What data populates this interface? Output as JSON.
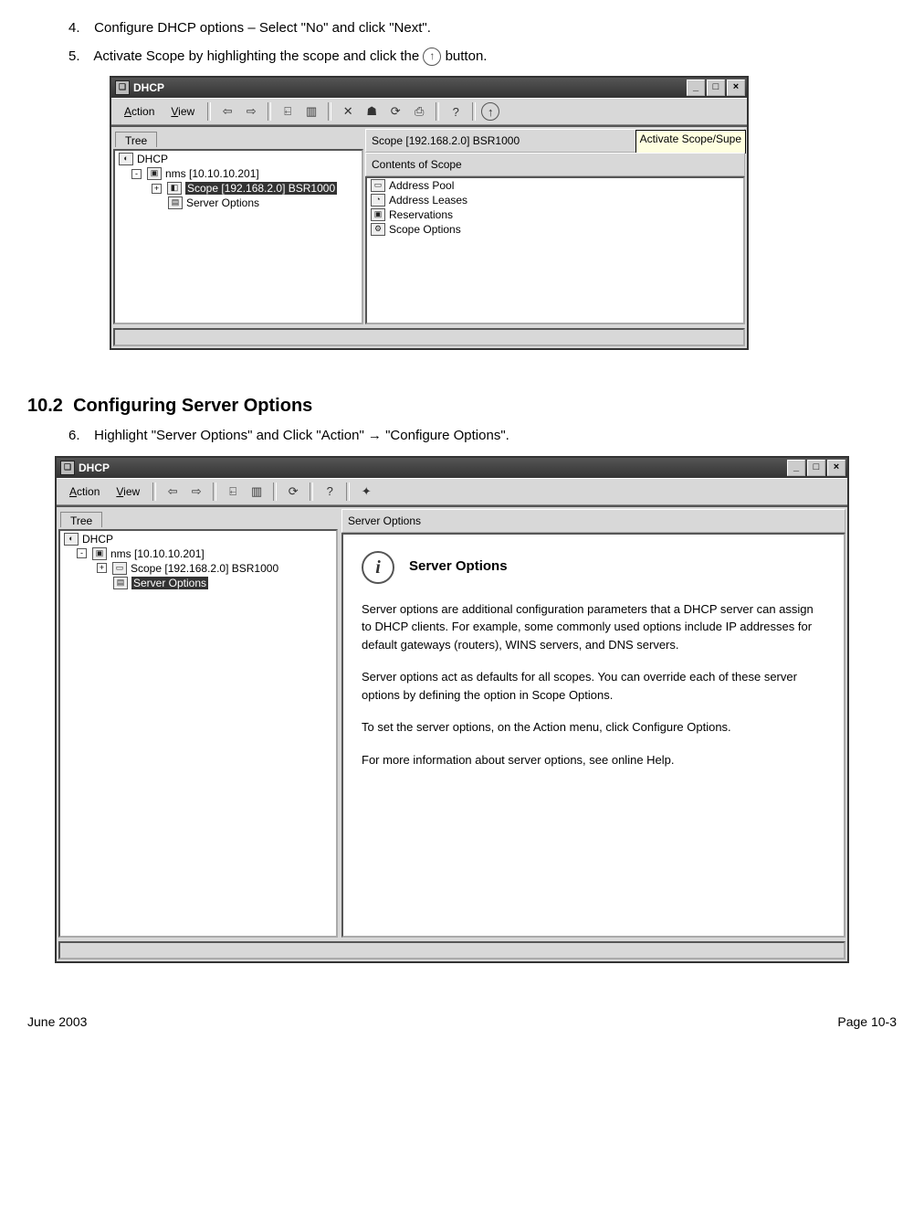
{
  "steps": {
    "s4": {
      "num": "4.",
      "text": "Configure DHCP options – Select \"No\" and click \"Next\"."
    },
    "s5": {
      "num": "5.",
      "text_a": "Activate Scope by highlighting the scope and click the",
      "text_b": "button."
    },
    "s6": {
      "num": "6.",
      "text": "Highlight \"Server Options\" and Click \"Action\" → \"Configure Options\"."
    }
  },
  "section": {
    "num": "10.2",
    "title": "Configuring Server Options"
  },
  "win1": {
    "title": "DHCP",
    "menus": {
      "action": "Action",
      "view": "View"
    },
    "tab": "Tree",
    "list_header": "Scope [192.168.2.0] BSR1000",
    "tooltip": "Activate Scope/Supe",
    "subheader": "Contents of Scope",
    "tree": {
      "root": "DHCP",
      "nms": "nms [10.10.10.201]",
      "scope": "Scope [192.168.2.0] BSR1000",
      "server_options": "Server Options"
    },
    "items": {
      "pool": "Address Pool",
      "leases": "Address Leases",
      "res": "Reservations",
      "opts": "Scope Options"
    }
  },
  "win2": {
    "title": "DHCP",
    "menus": {
      "action": "Action",
      "view": "View"
    },
    "tab": "Tree",
    "list_header": "Server Options",
    "tree": {
      "root": "DHCP",
      "nms": "nms [10.10.10.201]",
      "scope": "Scope [192.168.2.0] BSR1000",
      "server_options": "Server Options"
    },
    "info": {
      "title": "Server Options",
      "p1": "Server options are additional configuration parameters that a DHCP server can assign to DHCP clients. For example, some commonly used options include IP addresses for default gateways (routers), WINS servers, and DNS servers.",
      "p2": "Server options act as defaults for all scopes.  You can override each of these server options by defining the option in Scope Options.",
      "p3": "To set the server options, on the Action menu, click Configure Options.",
      "p4": "For more information about server options, see online Help."
    }
  },
  "footer": {
    "left": "June 2003",
    "right": "Page 10-3"
  }
}
